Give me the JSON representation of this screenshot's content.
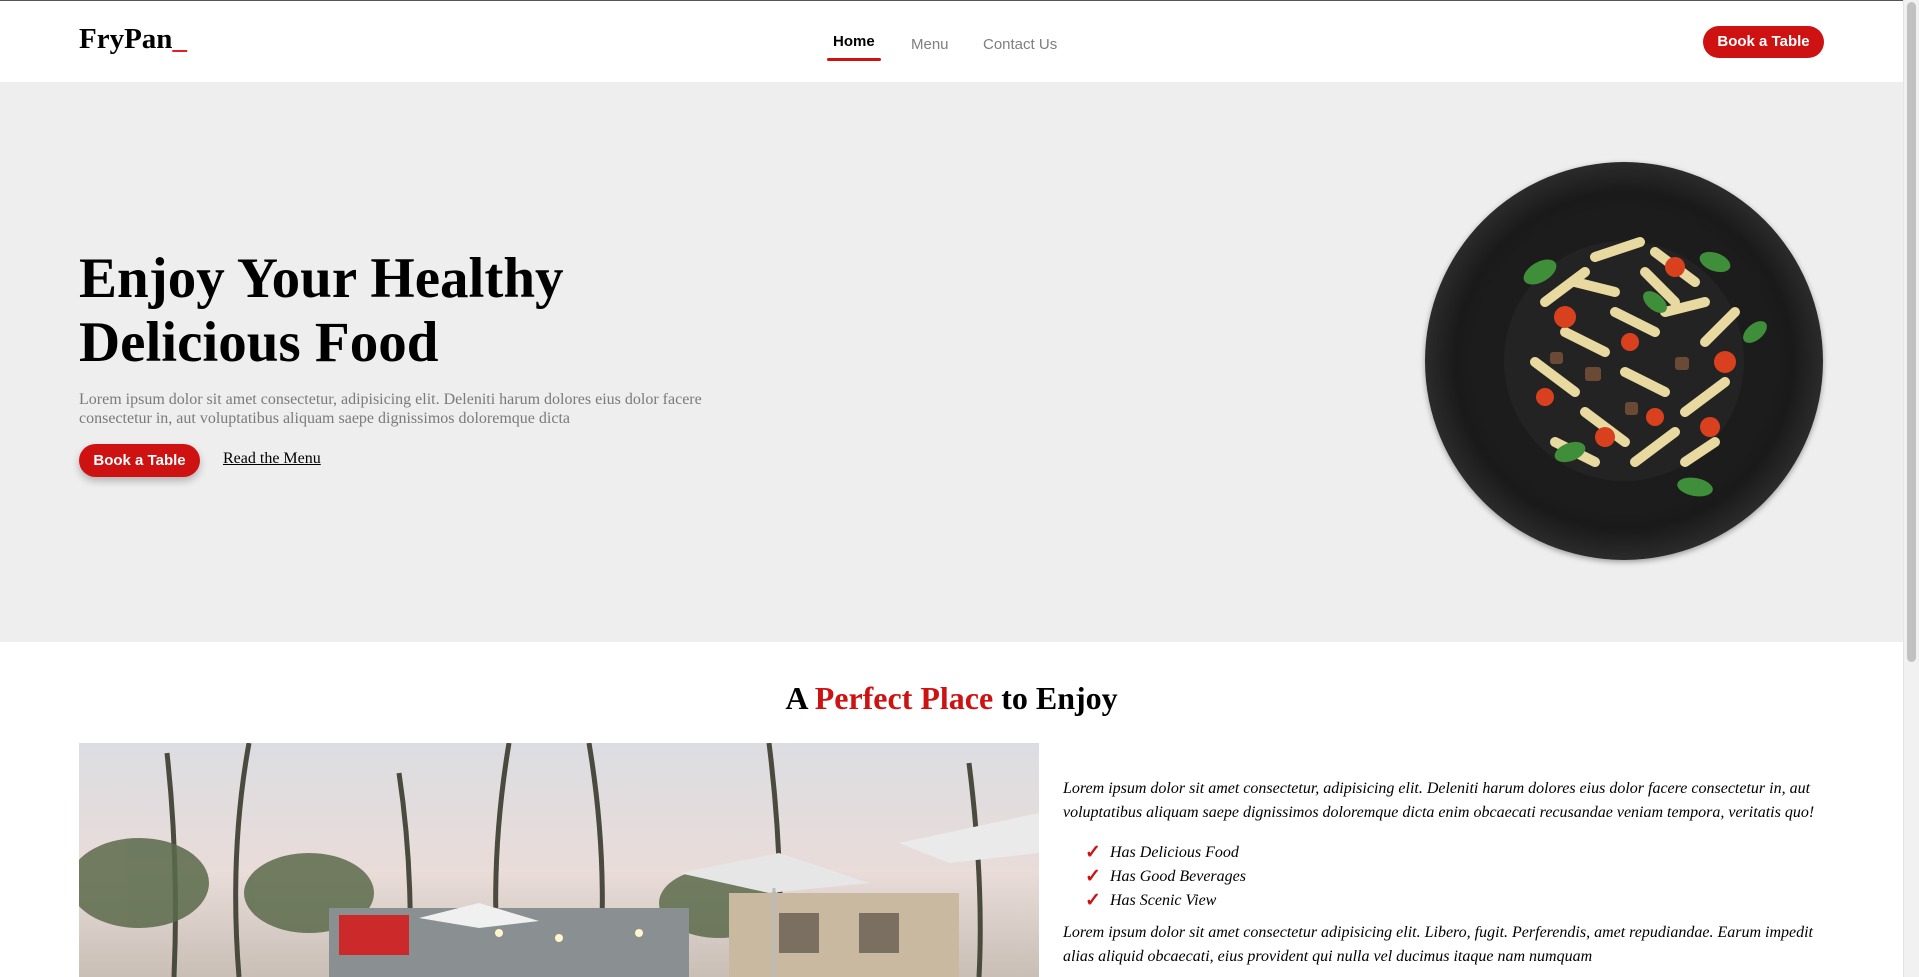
{
  "header": {
    "logo": "FryPan",
    "logo_cursor": "_",
    "nav": [
      {
        "label": "Home",
        "active": true
      },
      {
        "label": "Menu",
        "active": false
      },
      {
        "label": "Contact Us",
        "active": false
      }
    ],
    "cta_label": "Book a Table"
  },
  "hero": {
    "title": "Enjoy Your Healthy Delicious Food",
    "text": "Lorem ipsum dolor sit amet consectetur, adipisicing elit. Deleniti harum dolores eius dolor facere consectetur in, aut voluptatibus aliquam saepe dignissimos doloremque dicta",
    "primary_button": "Book a Table",
    "secondary_link": "Read the Menu",
    "image_icon": "pasta-plate-image"
  },
  "about": {
    "title_prefix": "A",
    "title_accent": "Perfect Place",
    "title_suffix": "to Enjoy",
    "para1": "Lorem ipsum dolor sit amet consectetur, adipisicing elit. Deleniti harum dolores eius dolor facere consectetur in, aut voluptatibus aliquam saepe dignissimos doloremque dicta enim obcaecati recusandae veniam tempora, veritatis quo!",
    "features": [
      "Has Delicious Food",
      "Has Good Beverages",
      "Has Scenic View"
    ],
    "check_icon": "checkmark-icon",
    "para2": "Lorem ipsum dolor sit amet consectetur adipisicing elit. Libero, fugit. Perferendis, amet repudiandae. Earum impedit alias aliquid obcaecati, eius provident qui nulla vel ducimus itaque nam numquam",
    "image_icon": "restaurant-venue-image"
  },
  "colors": {
    "accent": "#ce1212",
    "hero_bg": "#eeeeee",
    "muted_text": "#7a7a7a"
  }
}
